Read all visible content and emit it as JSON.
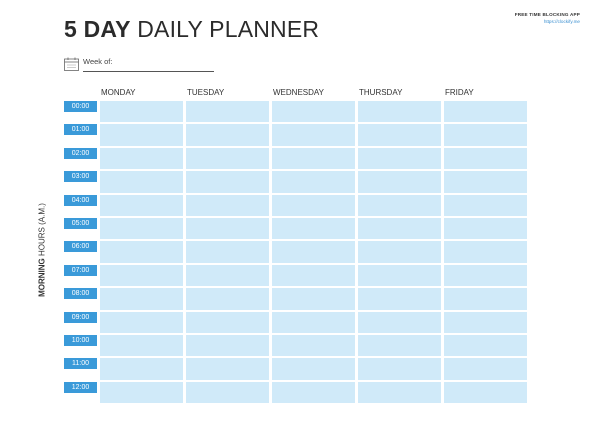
{
  "title": {
    "bold": "5 DAY",
    "rest": "DAILY PLANNER"
  },
  "brand": {
    "name": "FREE TIME BLOCKING APP",
    "url": "https://clockify.me"
  },
  "week": {
    "label": "Week of:",
    "icon": "calendar-icon"
  },
  "side_label": {
    "bold": "MORNING",
    "rest": "HOURS (A.M.)"
  },
  "days": [
    "MONDAY",
    "TUESDAY",
    "WEDNESDAY",
    "THURSDAY",
    "FRIDAY"
  ],
  "times": [
    "00:00",
    "01:00",
    "02:00",
    "03:00",
    "04:00",
    "05:00",
    "06:00",
    "07:00",
    "08:00",
    "09:00",
    "10:00",
    "11:00",
    "12:00"
  ],
  "colors": {
    "time_badge": "#3a9ad9",
    "cell": "#d0eaf9",
    "brand_url": "#3a8fd0"
  }
}
